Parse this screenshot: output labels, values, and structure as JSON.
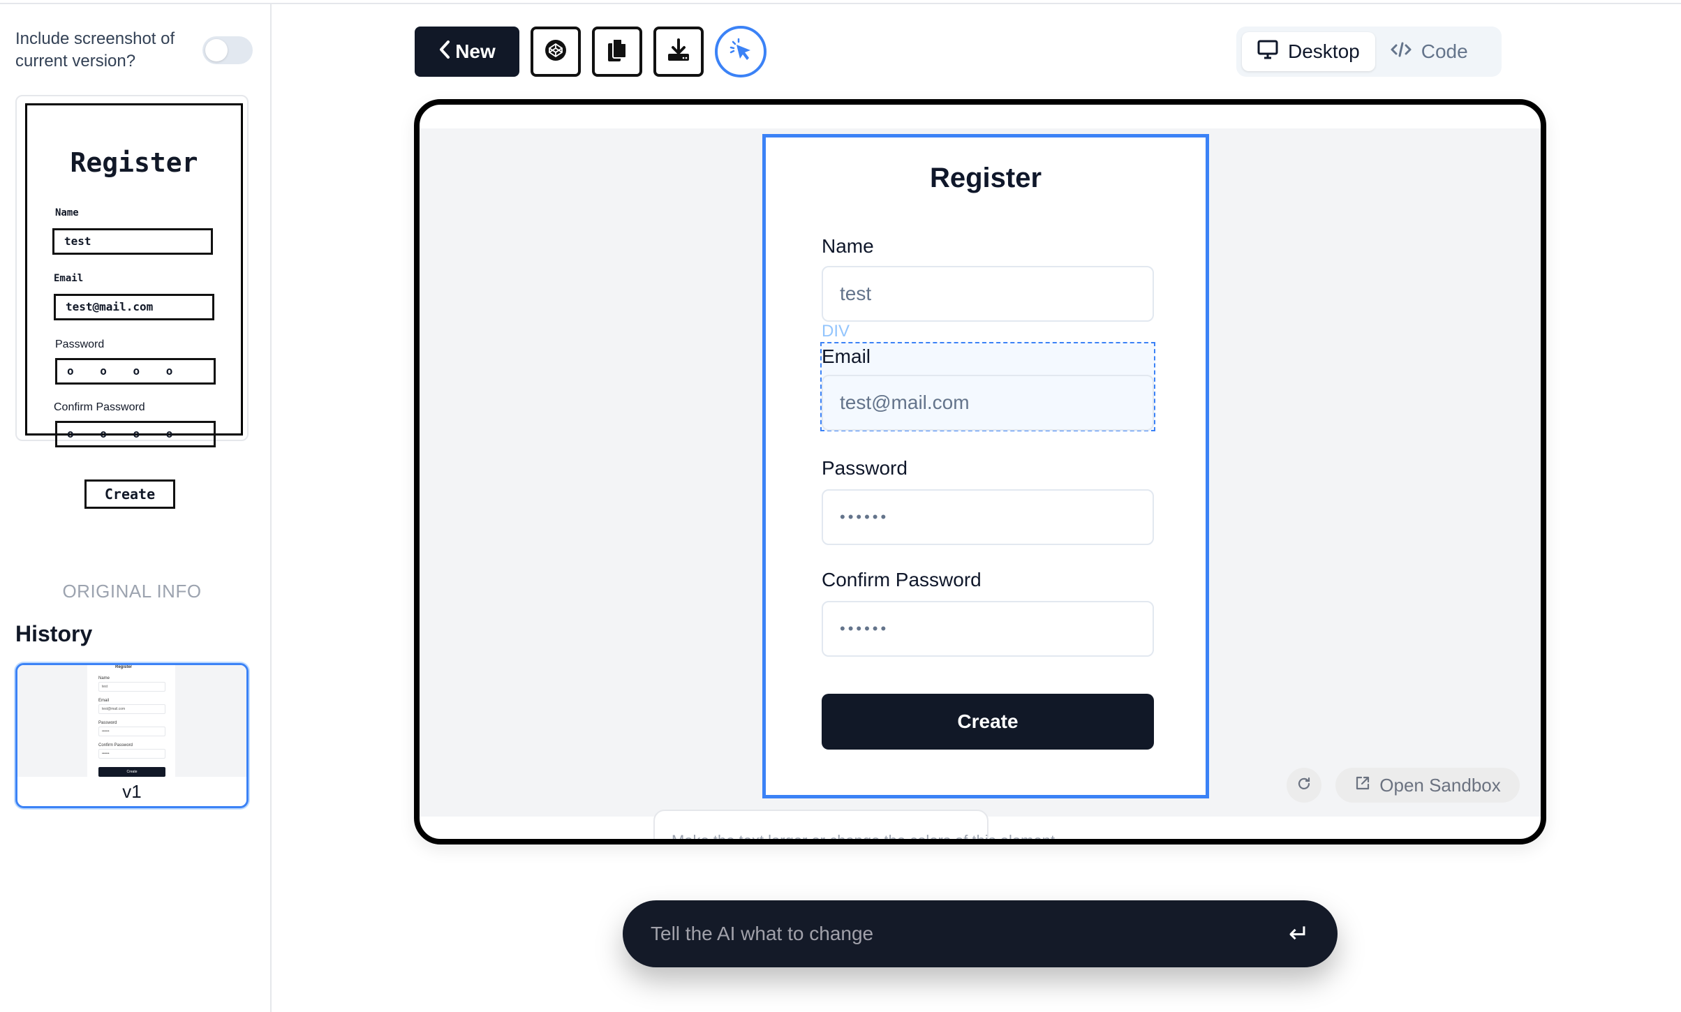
{
  "sidebar": {
    "toggle_label": "Include screenshot of current version?",
    "toggle_on": false,
    "original_sketch": {
      "title": "Register",
      "fields": [
        {
          "label": "Name",
          "value": "test"
        },
        {
          "label": "Email",
          "value": "test@mail.com"
        },
        {
          "label": "Password",
          "value": "o o o o"
        },
        {
          "label": "Confirm Password",
          "value": "o o o o"
        }
      ],
      "button": "Create"
    },
    "original_info_label": "ORIGINAL INFO",
    "history_title": "History",
    "history": [
      {
        "version": "v1",
        "thumb_title": "Register",
        "thumb_fields": [
          {
            "label": "Name",
            "value": "test"
          },
          {
            "label": "Email",
            "value": "test@mail.com"
          },
          {
            "label": "Password",
            "value": "••••••"
          },
          {
            "label": "Confirm Password",
            "value": "••••••"
          }
        ],
        "thumb_button": "Create"
      }
    ]
  },
  "toolbar": {
    "new_label": "New",
    "new_icon": "chevron-left-icon",
    "icons": [
      "codepen-icon",
      "copy-icon",
      "download-icon",
      "select-element-icon"
    ],
    "view_options": [
      {
        "label": "Desktop",
        "icon": "monitor-icon",
        "active": true
      },
      {
        "label": "Code",
        "icon": "code-icon",
        "active": false
      }
    ]
  },
  "preview": {
    "title": "Register",
    "fields": [
      {
        "label": "Name",
        "value": "test"
      },
      {
        "label": "Email",
        "value": "test@mail.com"
      },
      {
        "label": "Password",
        "value": "••••••"
      },
      {
        "label": "Confirm Password",
        "value": "••••••"
      }
    ],
    "button": "Create",
    "selected_element_tag": "DIV",
    "refresh_icon": "refresh-icon",
    "open_sandbox_label": "Open Sandbox",
    "edit_placeholder": "Make the text larger or change the colors of this element."
  },
  "chat": {
    "placeholder": "Tell the AI what to change",
    "enter_icon": "↵"
  },
  "colors": {
    "accent": "#3b82f6",
    "dark": "#111827",
    "muted": "#64748b"
  }
}
